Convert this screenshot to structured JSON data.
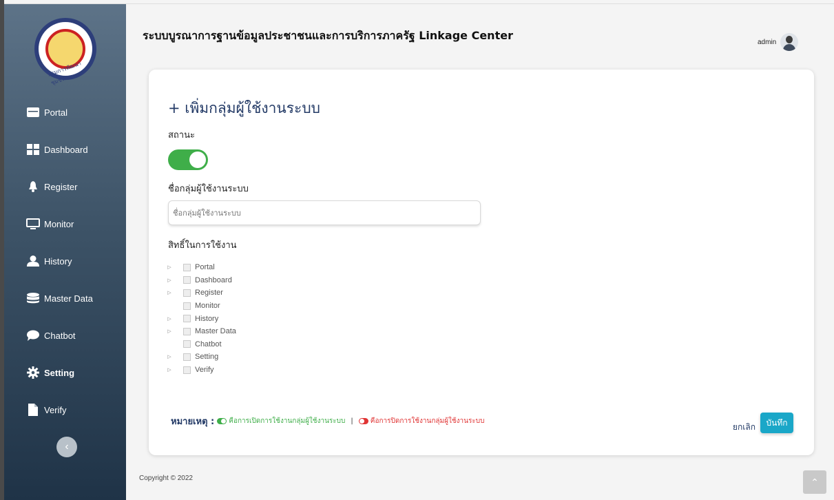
{
  "header": {
    "title": "ระบบบูรณาการฐานข้อมูลประชาชนและการบริการภาครัฐ Linkage Center",
    "user_name": "admin"
  },
  "logo": {
    "text": "กรมการพัฒนาชุมชน"
  },
  "sidebar": {
    "items": [
      {
        "label": "Portal",
        "icon": "portal-icon"
      },
      {
        "label": "Dashboard",
        "icon": "dashboard-icon"
      },
      {
        "label": "Register",
        "icon": "bell-icon"
      },
      {
        "label": "Monitor",
        "icon": "monitor-icon"
      },
      {
        "label": "History",
        "icon": "user-icon"
      },
      {
        "label": "Master Data",
        "icon": "database-icon"
      },
      {
        "label": "Chatbot",
        "icon": "chat-icon"
      },
      {
        "label": "Setting",
        "icon": "gear-icon"
      },
      {
        "label": "Verify",
        "icon": "file-icon"
      }
    ],
    "active": "Setting"
  },
  "form": {
    "title": "+ เพิ่มกลุ่มผู้ใช้งานระบบ",
    "status_label": "สถานะ",
    "status_on": true,
    "name_label": "ชื่อกลุ่มผู้ใช้งานระบบ",
    "name_placeholder": "ชื่อกลุ่มผู้ใช้งานระบบ",
    "permissions_label": "สิทธิ์ในการใช้งาน",
    "tree": [
      {
        "label": "Portal",
        "expandable": true
      },
      {
        "label": "Dashboard",
        "expandable": true
      },
      {
        "label": "Register",
        "expandable": true
      },
      {
        "label": "Monitor",
        "expandable": false
      },
      {
        "label": "History",
        "expandable": true
      },
      {
        "label": "Master Data",
        "expandable": true
      },
      {
        "label": "Chatbot",
        "expandable": false
      },
      {
        "label": "Setting",
        "expandable": true
      },
      {
        "label": "Verify",
        "expandable": true
      }
    ]
  },
  "note": {
    "label": "หมายเหตุ :",
    "on_text": "คือการเปิดการใช้งานกลุ่มผู้ใช้งานระบบ",
    "separator": "|",
    "off_text": "คือการปิดการใช้งานกลุ่มผู้ใช้งานระบบ"
  },
  "actions": {
    "cancel": "ยกเลิก",
    "save": "บันทึก"
  },
  "footer": {
    "copyright": "Copyright © 2022"
  },
  "colors": {
    "accent": "#1aa7c8",
    "toggle_on": "#3fae49",
    "toggle_off": "#e03434",
    "title": "#233a66"
  }
}
